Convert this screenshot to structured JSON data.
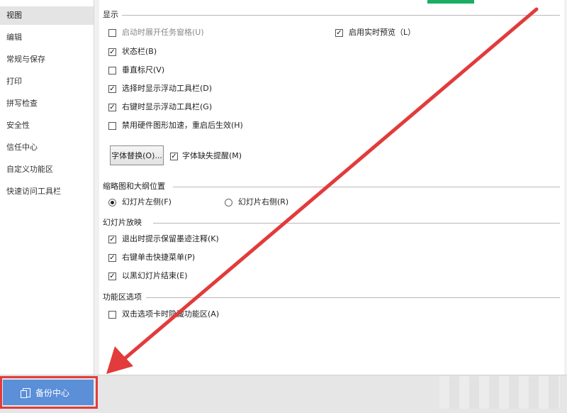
{
  "sidebar": {
    "items": [
      {
        "label": "视图"
      },
      {
        "label": "编辑"
      },
      {
        "label": "常规与保存"
      },
      {
        "label": "打印"
      },
      {
        "label": "拼写检查"
      },
      {
        "label": "安全性"
      },
      {
        "label": "信任中心"
      },
      {
        "label": "自定义功能区"
      },
      {
        "label": "快速访问工具栏"
      }
    ],
    "active_index": 0
  },
  "sections": {
    "display": {
      "title": "显示",
      "options": [
        {
          "label": "启动时展开任务窗格(U)",
          "checked": false,
          "disabled": true
        },
        {
          "label": "启用实时预览（L）",
          "checked": true
        },
        {
          "label": "状态栏(B)",
          "checked": true
        },
        {
          "label": "垂直标尺(V)",
          "checked": false
        },
        {
          "label": "选择时显示浮动工具栏(D)",
          "checked": true
        },
        {
          "label": "右键时显示浮动工具栏(G)",
          "checked": true
        },
        {
          "label": "禁用硬件图形加速，重启后生效(H)",
          "checked": false
        },
        {
          "label": "字体缺失提醒(M)",
          "checked": true
        }
      ],
      "font_replace_button": "字体替换(O)..."
    },
    "thumbnail": {
      "title": "缩略图和大纲位置",
      "options": [
        {
          "label": "幻灯片左侧(F)",
          "selected": true
        },
        {
          "label": "幻灯片右侧(R)",
          "selected": false
        }
      ]
    },
    "slideshow": {
      "title": "幻灯片放映",
      "options": [
        {
          "label": "退出时提示保留墨迹注释(K)",
          "checked": true
        },
        {
          "label": "右键单击快捷菜单(P)",
          "checked": true
        },
        {
          "label": "以黑幻灯片结束(E)",
          "checked": true
        }
      ]
    },
    "ribbon": {
      "title": "功能区选项",
      "options": [
        {
          "label": "双击选项卡时隐藏功能区(A)",
          "checked": false
        }
      ]
    }
  },
  "footer": {
    "backup_label": "备份中心"
  },
  "colors": {
    "accent": "#5b8fd8",
    "annotation_red": "#e23b3b",
    "green_tab": "#1aad63"
  },
  "check_mark": "✓"
}
